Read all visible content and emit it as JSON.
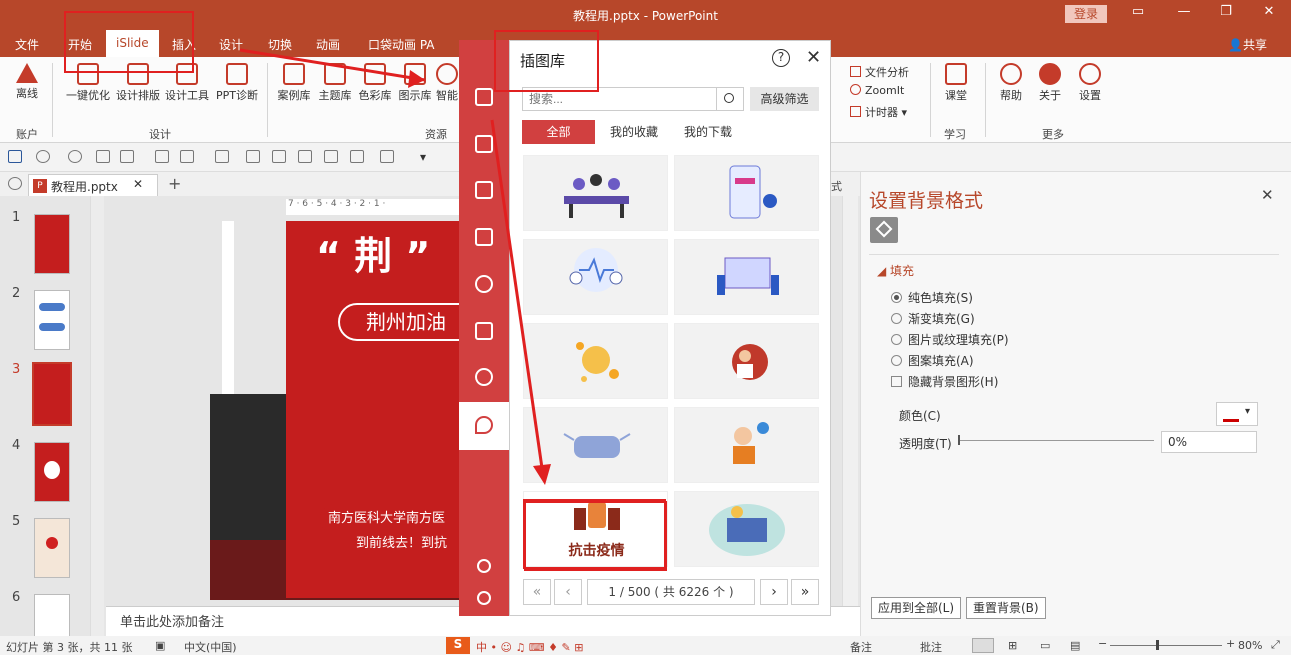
{
  "window": {
    "title": "教程用.pptx - PowerPoint",
    "login": "登录"
  },
  "menu": {
    "tabs": [
      "文件",
      "开始",
      "iSlide",
      "插入",
      "设计",
      "切换",
      "动画",
      "口袋动画 PA"
    ],
    "share": "共享"
  },
  "ribbon": {
    "buttons": [
      "离线",
      "一键优化",
      "设计排版",
      "设计工具",
      "PPT诊断",
      "案例库",
      "主题库",
      "色彩库",
      "图示库",
      "智能",
      "课堂",
      "帮助",
      "关于",
      "设置"
    ],
    "small": [
      "文件分析",
      "ZoomIt",
      "计时器"
    ],
    "groups": [
      "账户",
      "设计",
      "资源",
      "学习",
      "更多"
    ]
  },
  "doc_tab": {
    "name": "教程用.pptx"
  },
  "slides": {
    "numbers": [
      "1",
      "2",
      "3",
      "4",
      "5",
      "6"
    ],
    "active": "3"
  },
  "slide": {
    "title": "“ 荆 ”",
    "pill": "荆州加油",
    "banner1": "南方医科大学南方医",
    "banner2": "到前线去！到抗"
  },
  "notes": {
    "placeholder": "单击此处添加备注"
  },
  "dialog": {
    "title": "插图库",
    "search_placeholder": "搜索...",
    "advanced": "高级筛选",
    "filters": [
      "全部",
      "我的收藏",
      "我的下载"
    ],
    "card_text": "抗击疫情",
    "page": "1 / 500 ( 共 6226 个 )"
  },
  "format_pane": {
    "tab_hint": "式",
    "title": "设置背景格式",
    "fill_header": "填充",
    "options": [
      "纯色填充(S)",
      "渐变填充(G)",
      "图片或纹理填充(P)",
      "图案填充(A)"
    ],
    "hide_bg": "隐藏背景图形(H)",
    "color_label": "颜色(C)",
    "transparency_label": "透明度(T)",
    "transparency_value": "0%",
    "apply_all": "应用到全部(L)",
    "reset": "重置背景(B)"
  },
  "status": {
    "slide_info": "幻灯片 第 3 张，共 11 张",
    "language": "中文(中国)",
    "notes": "备注",
    "comments": "批注",
    "zoom": "80%"
  },
  "colors": {
    "accent": "#b7472a",
    "plugin": "#d14040",
    "highlight": "#e02020"
  }
}
